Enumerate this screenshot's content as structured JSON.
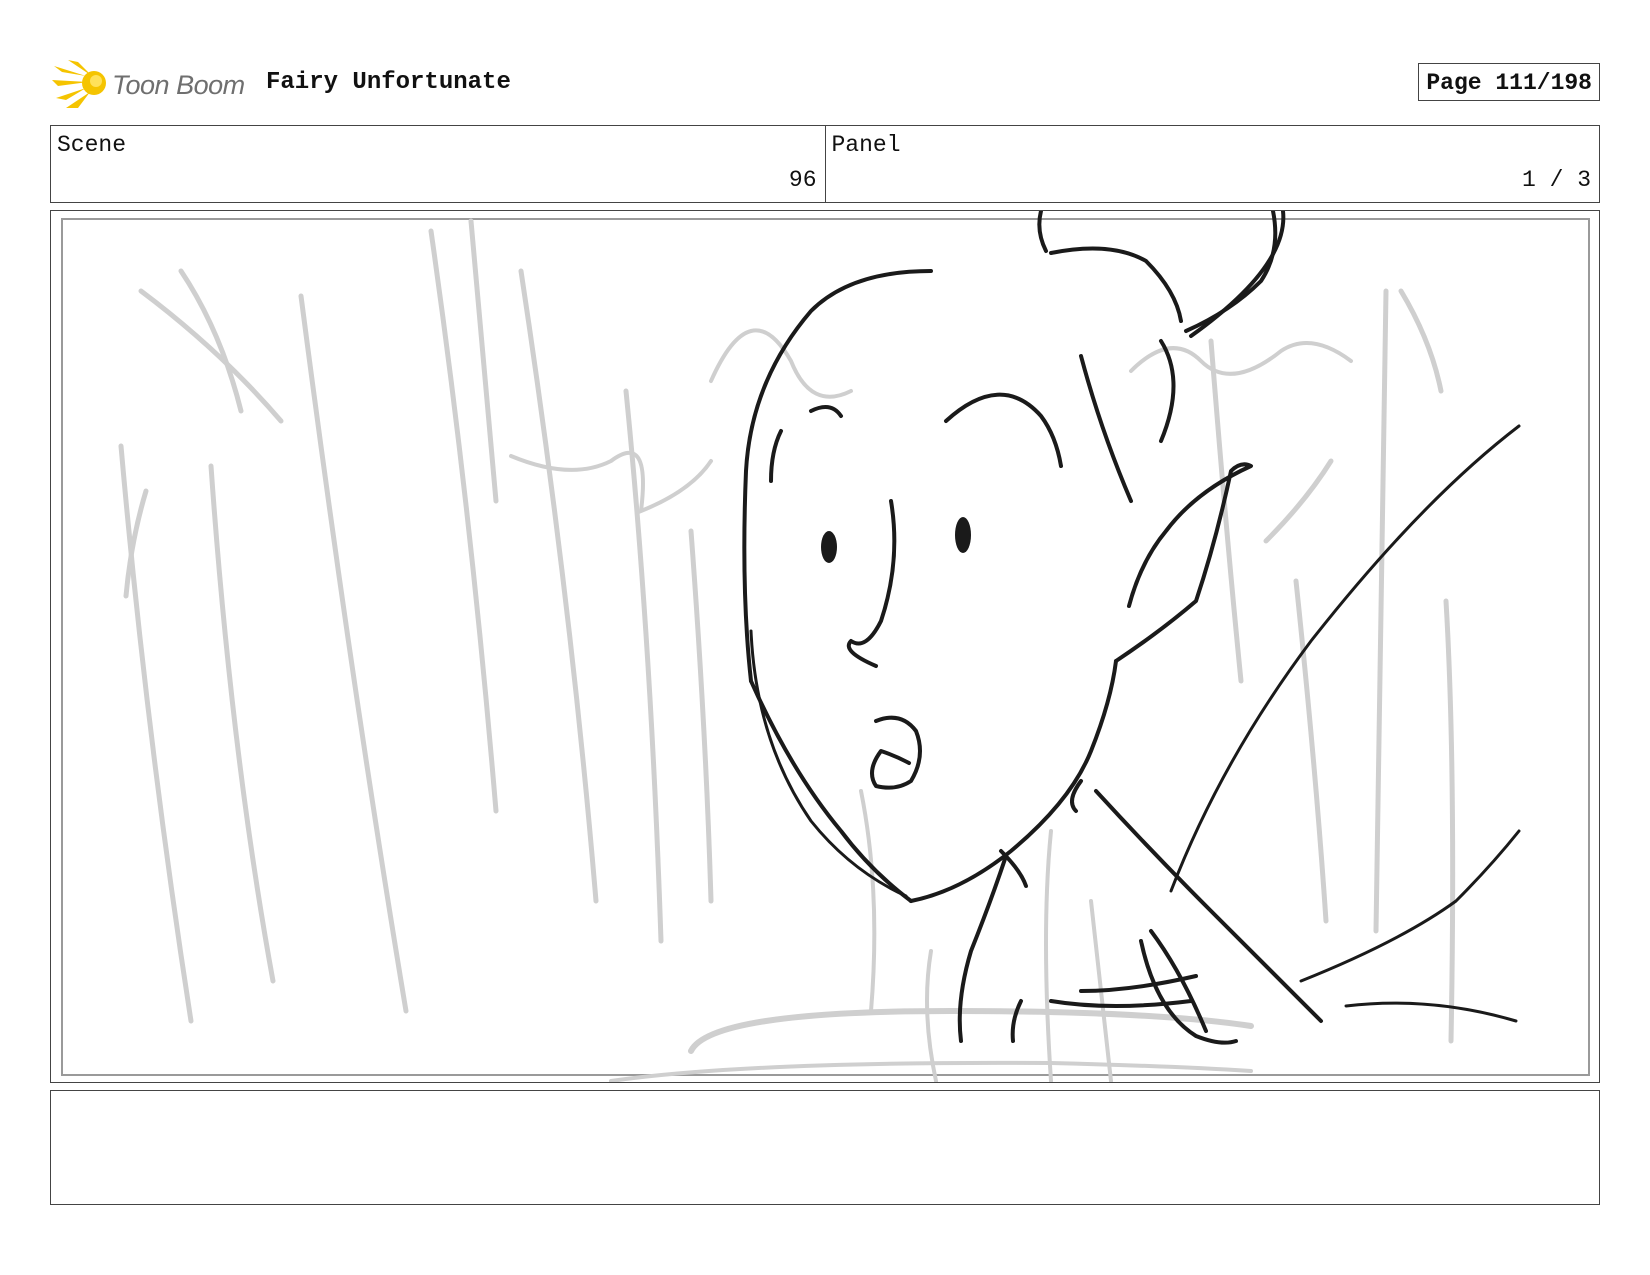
{
  "header": {
    "logo_text": "Toon Boom",
    "project_title": "Fairy Unfortunate",
    "page_label": "Page 111/198"
  },
  "scene": {
    "label": "Scene",
    "value": "96"
  },
  "panel": {
    "label": "Panel",
    "value": "1 / 3"
  },
  "notes": {
    "text": ""
  },
  "colors": {
    "logo_yellow": "#f5c400",
    "logo_grey": "#6f6f6f",
    "border": "#444444"
  }
}
